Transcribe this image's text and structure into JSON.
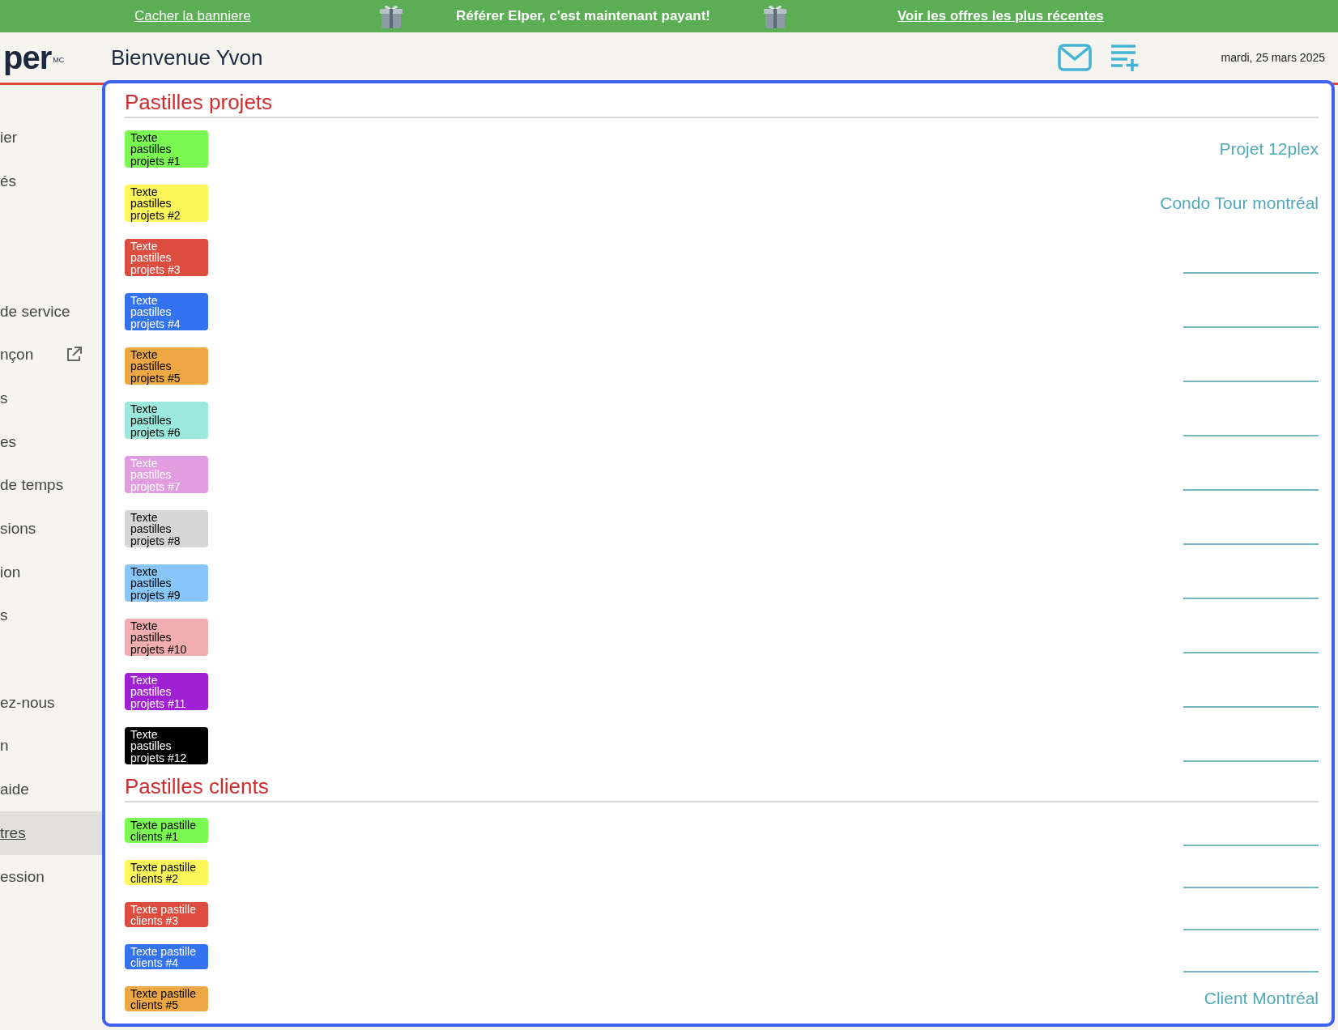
{
  "banner": {
    "hide_link": "Cacher la banniere",
    "message": "Référer Elper, c'est maintenant payant!",
    "offers_link": "Voir les offres les plus récentes"
  },
  "header": {
    "logo": "per",
    "logo_mark": "MC",
    "greeting": "Bienvenue Yvon",
    "date": "mardi, 25 mars 2025"
  },
  "sidebar": {
    "items": [
      {
        "kind": "link",
        "label": "ier",
        "selected": false
      },
      {
        "kind": "link",
        "label": "és",
        "selected": false
      },
      {
        "kind": "spacer"
      },
      {
        "kind": "spacer"
      },
      {
        "kind": "link",
        "label": "de service",
        "selected": false
      },
      {
        "kind": "external",
        "label": "nçon",
        "selected": false
      },
      {
        "kind": "link",
        "label": "s",
        "selected": false
      },
      {
        "kind": "link",
        "label": "es",
        "selected": false
      },
      {
        "kind": "link",
        "label": "de temps",
        "selected": false
      },
      {
        "kind": "link",
        "label": "sions",
        "selected": false
      },
      {
        "kind": "link",
        "label": "ion",
        "selected": false
      },
      {
        "kind": "link",
        "label": "s",
        "selected": false
      },
      {
        "kind": "spacer"
      },
      {
        "kind": "link",
        "label": "ez-nous",
        "selected": false
      },
      {
        "kind": "link",
        "label": "n",
        "selected": false
      },
      {
        "kind": "link",
        "label": "aide",
        "selected": false
      },
      {
        "kind": "link",
        "label": "tres",
        "selected": true
      },
      {
        "kind": "link",
        "label": "ession",
        "selected": false
      }
    ]
  },
  "sections": [
    {
      "kind": "projects",
      "title": "Pastilles projets",
      "rows": [
        {
          "pill": "Texte pastilles projets #1",
          "color": "#7bfa52",
          "light_text": false,
          "kind": "label",
          "label": "Projet 12plex"
        },
        {
          "pill": "Texte pastilles projets #2",
          "color": "#fdf75a",
          "light_text": false,
          "kind": "label",
          "label": "Condo Tour montréal"
        },
        {
          "pill": "Texte pastilles projets #3",
          "color": "#dc4c3f",
          "light_text": true,
          "kind": "blank"
        },
        {
          "pill": "Texte pastilles projets #4",
          "color": "#3473f0",
          "light_text": true,
          "kind": "blank"
        },
        {
          "pill": "Texte pastilles projets #5",
          "color": "#eea843",
          "light_text": false,
          "kind": "blank"
        },
        {
          "pill": "Texte pastilles projets #6",
          "color": "#9be9dc",
          "light_text": false,
          "kind": "blank"
        },
        {
          "pill": "Texte pastilles projets #7",
          "color": "#e29de0",
          "light_text": true,
          "kind": "blank"
        },
        {
          "pill": "Texte pastilles projets #8",
          "color": "#d6d6d6",
          "light_text": false,
          "kind": "blank"
        },
        {
          "pill": "Texte pastilles projets #9",
          "color": "#88c5f8",
          "light_text": false,
          "kind": "blank"
        },
        {
          "pill": "Texte pastilles projets #10",
          "color": "#f2adb0",
          "light_text": false,
          "kind": "blank"
        },
        {
          "pill": "Texte pastilles projets #11",
          "color": "#a021d3",
          "light_text": true,
          "kind": "blank"
        },
        {
          "pill": "Texte pastilles projets #12",
          "color": "#000000",
          "light_text": true,
          "kind": "blank"
        }
      ]
    },
    {
      "kind": "clients",
      "title": "Pastilles clients",
      "rows": [
        {
          "pill": "Texte pastille clients #1",
          "color": "#7bfa52",
          "light_text": false,
          "kind": "blank"
        },
        {
          "pill": "Texte pastille clients #2",
          "color": "#fdf75a",
          "light_text": false,
          "kind": "blank"
        },
        {
          "pill": "Texte pastille clients #3",
          "color": "#dc4c3f",
          "light_text": true,
          "kind": "blank"
        },
        {
          "pill": "Texte pastille clients #4",
          "color": "#3473f0",
          "light_text": true,
          "kind": "blank"
        },
        {
          "pill": "Texte pastille clients #5",
          "color": "#eea843",
          "light_text": false,
          "kind": "label",
          "label": "Client Montréal"
        }
      ]
    }
  ]
}
